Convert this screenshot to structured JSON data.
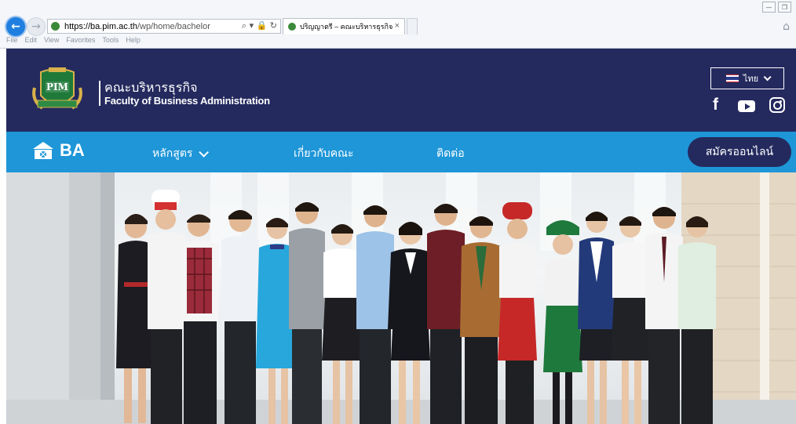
{
  "browser": {
    "url_host": "https://ba.pim.ac.th",
    "url_path": "/wp/home/bachelor",
    "addr_icons": "⌕ ▾ 🔒 ↻",
    "tab_title": "ปริญญาตรี – คณะบริหารธุรกิจ",
    "tab_close": "×",
    "win_min": "—",
    "win_max": "❐",
    "menu": [
      "File",
      "Edit",
      "View",
      "Favorites",
      "Tools",
      "Help"
    ]
  },
  "header": {
    "logo_text": "PIM",
    "faculty_th": "คณะบริหารธุรกิจ",
    "faculty_en": "Faculty of Business Administration",
    "lang_label": "ไทย",
    "social_fb": "f"
  },
  "nav": {
    "brand": "BA",
    "items": [
      {
        "label": "หลักสูตร"
      },
      {
        "label": "เกี่ยวกับคณะ"
      },
      {
        "label": "ติดต่อ"
      }
    ],
    "apply_label": "สมัครออนไลน์"
  },
  "colors": {
    "header_bg": "#242a5e",
    "nav_bg": "#1e96d8",
    "apply_bg": "#242a5e"
  }
}
